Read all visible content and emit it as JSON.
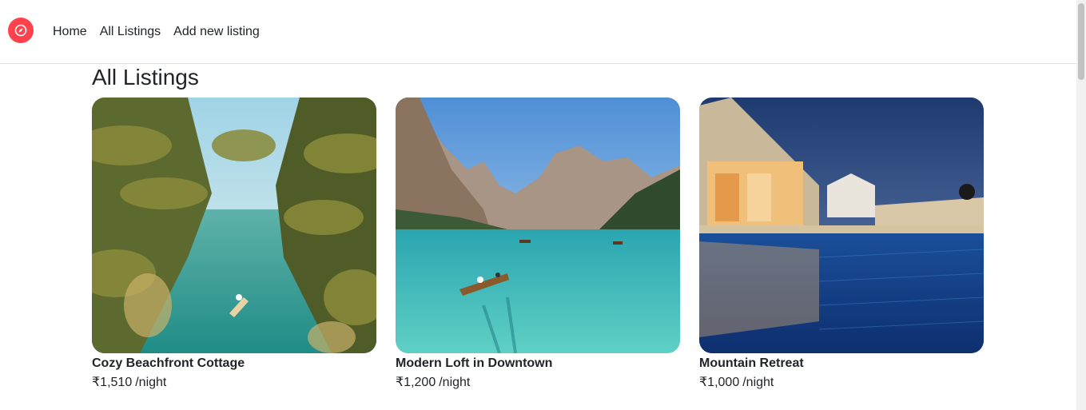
{
  "nav": {
    "brand_icon": "compass-icon",
    "brand_color": "#fe424d",
    "links": [
      {
        "label": "Home"
      },
      {
        "label": "All Listings"
      },
      {
        "label": "Add new listing"
      }
    ]
  },
  "page": {
    "title": "All Listings"
  },
  "listings": [
    {
      "title": "Cozy Beachfront Cottage",
      "price": "₹1,510",
      "per": "/night",
      "image": "tropical-river-palms"
    },
    {
      "title": "Modern Loft in Downtown",
      "price": "₹1,200",
      "per": "/night",
      "image": "mountain-lake-boat"
    },
    {
      "title": "Mountain Retreat",
      "price": "₹1,000",
      "per": "/night",
      "image": "resort-pool-night"
    }
  ]
}
